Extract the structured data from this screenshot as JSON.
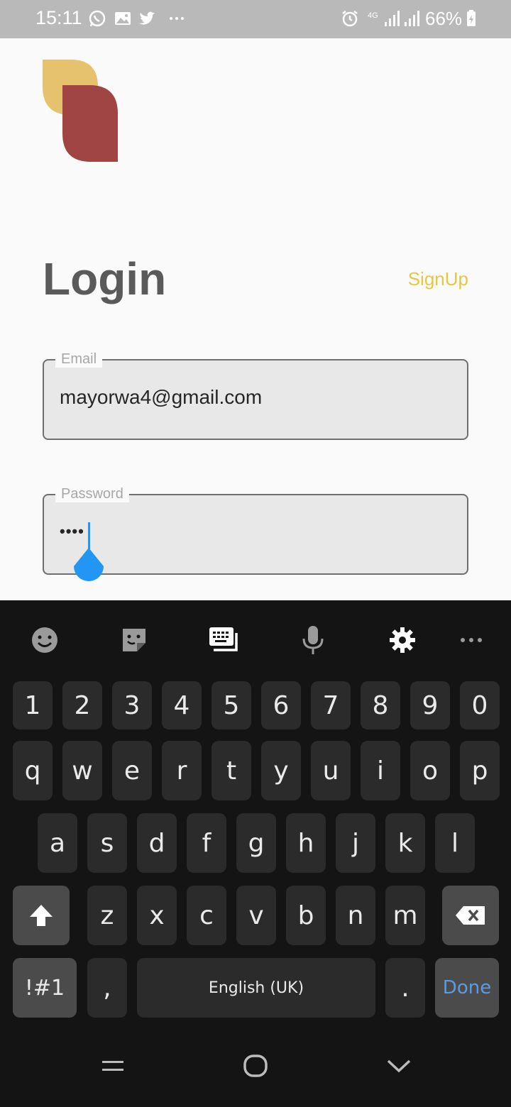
{
  "status_bar": {
    "time": "15:11",
    "battery": "66%",
    "network": "4G",
    "left_icons": [
      "whatsapp-icon",
      "gallery-icon",
      "twitter-icon",
      "more-dots-icon"
    ],
    "right_icons": [
      "alarm-icon",
      "signal-icon",
      "signal-icon",
      "battery-icon"
    ]
  },
  "app": {
    "logo": {
      "colors": [
        "#e6c26e",
        "#a04544"
      ]
    },
    "title": "Login",
    "signup_link": "SignUp",
    "email": {
      "label": "Email",
      "value": "mayorwa4@gmail.com"
    },
    "password": {
      "label": "Password",
      "value_masked": "••••"
    },
    "accent": "#e2c940",
    "cursor_color": "#2196f3"
  },
  "keyboard": {
    "toolbar": [
      "emoji-icon",
      "sticker-icon",
      "keyboard-icon",
      "mic-icon",
      "settings-icon",
      "more-icon"
    ],
    "number_row": [
      "1",
      "2",
      "3",
      "4",
      "5",
      "6",
      "7",
      "8",
      "9",
      "0"
    ],
    "row_q": [
      "q",
      "w",
      "e",
      "r",
      "t",
      "y",
      "u",
      "i",
      "o",
      "p"
    ],
    "row_a": [
      "a",
      "s",
      "d",
      "f",
      "g",
      "h",
      "j",
      "k",
      "l"
    ],
    "row_z": [
      "z",
      "x",
      "c",
      "v",
      "b",
      "n",
      "m"
    ],
    "symbols_key": "!#1",
    "comma_key": ",",
    "space_label": "English (UK)",
    "period_key": ".",
    "done_key": "Done"
  },
  "nav_bar": [
    "recent-apps-icon",
    "home-icon",
    "back-icon"
  ]
}
